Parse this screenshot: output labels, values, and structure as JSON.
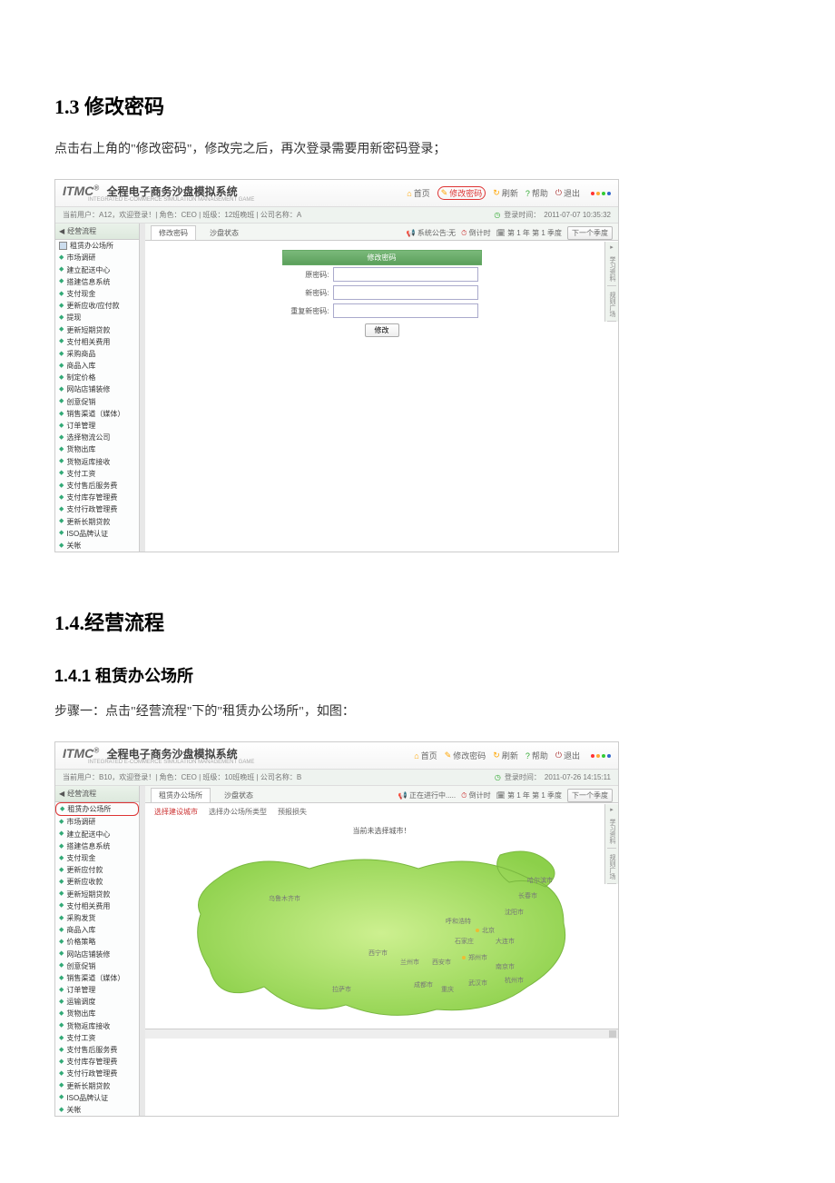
{
  "doc": {
    "h1_3": "1.3 修改密码",
    "p1_3": "点击右上角的\"修改密码\"，修改完之后，再次登录需要用新密码登录；",
    "h1_4": "1.4.经营流程",
    "h1_4_1": "1.4.1 租赁办公场所",
    "p1_4_1": "步骤一：点击\"经营流程\"下的\"租赁办公场所\"，如图："
  },
  "common": {
    "logo": "ITMC",
    "logo_r": "®",
    "system_title": "全程电子商务沙盘模拟系统",
    "system_sub": "INTEGRATED E-COMMERCE SIMULATION MANAGEMENT GAME",
    "header_links": {
      "home": "首页",
      "pwd": "修改密码",
      "refresh": "刷新",
      "help": "帮助",
      "exit": "退出"
    },
    "quarter_btn": "下一个季度",
    "quarter_info_prefix": "第",
    "quarter_info": "第 1 年 第 1 季度"
  },
  "shot1": {
    "user_info": "当前用户：A12，欢迎登录！| 角色：CEO | 班级：12班晚班 | 公司名称：A",
    "login_time_label": "登录时间：",
    "login_time": "2011-07-07 10:35:32",
    "sidebar_title": "经营流程",
    "sidebar": [
      "租赁办公场所",
      "市场调研",
      "建立配送中心",
      "搭建信息系统",
      "支付现金",
      "更新应收/应付款",
      "提现",
      "更新短期贷款",
      "支付相关费用",
      "采购商品",
      "商品入库",
      "制定价格",
      "网站店铺装修",
      "创意促销",
      "销售渠道（媒体）",
      "订单管理",
      "选择物流公司",
      "货物出库",
      "货物返库接收",
      "支付工资",
      "支付售后服务费",
      "支付库存管理费",
      "支付行政管理费",
      "更新长期贷款",
      "ISO品牌认证",
      "关帐"
    ],
    "tabs": {
      "t1": "修改密码",
      "t2": "沙盘状态"
    },
    "tabs_right": {
      "pub": "系统公告:无",
      "timer": "倒计时"
    },
    "form": {
      "title": "修改密码",
      "old": "原密码:",
      "new": "新密码:",
      "repeat": "重复新密码:",
      "btn": "修改"
    },
    "right_widget": [
      "学习资料",
      "规则广场"
    ]
  },
  "shot2": {
    "user_info": "当前用户：B10，欢迎登录！| 角色：CEO | 班级：10班晚班 | 公司名称：B",
    "login_time_label": "登录时间：",
    "login_time": "2011-07-26 14:15:11",
    "sidebar_title": "经营流程",
    "sidebar": [
      "租赁办公场所",
      "市场调研",
      "建立配送中心",
      "搭建信息系统",
      "支付现金",
      "更新应付款",
      "更新应收款",
      "更新短期贷款",
      "支付相关费用",
      "采购发货",
      "商品入库",
      "价格策略",
      "网站店铺装修",
      "创意促销",
      "销售渠道（媒体）",
      "订单管理",
      "运输调度",
      "货物出库",
      "货物返库接收",
      "支付工资",
      "支付售后服务费",
      "支付库存管理费",
      "支付行政管理费",
      "更新长期贷款",
      "ISO品牌认证",
      "关帐"
    ],
    "tabs": {
      "t1": "租赁办公场所",
      "t2": "沙盘状态"
    },
    "tabs_right": {
      "pub": "正在进行中.....",
      "timer": "倒计时"
    },
    "sub_tabs": {
      "s1": "选择建设城市",
      "s2": "选择办公场所类型",
      "s3": "预报损失"
    },
    "map_note": "当前未选择城市！",
    "cities": [
      "乌鲁木齐市",
      "哈尔滨市",
      "长春市",
      "沈阳市",
      "呼和浩特",
      "北京",
      "石家庄",
      "大连市",
      "西宁市",
      "兰州市",
      "西安市",
      "郑州市",
      "南京市",
      "成都市",
      "重庆",
      "武汉市",
      "杭州市",
      "拉萨市"
    ],
    "right_widget": [
      "学习资料",
      "规则广场"
    ]
  }
}
